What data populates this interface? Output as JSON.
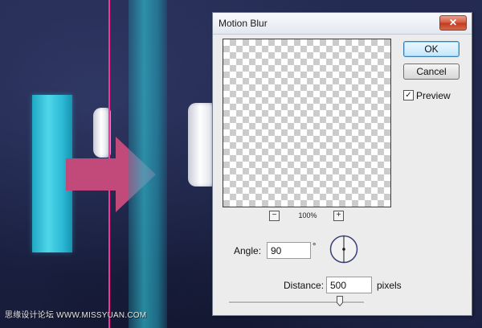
{
  "dialog": {
    "title": "Motion Blur",
    "close_label": "✕",
    "ok_label": "OK",
    "cancel_label": "Cancel",
    "preview_label": "Preview",
    "preview_checked": true,
    "zoom": {
      "minus_label": "−",
      "level": "100%",
      "plus_label": "+"
    },
    "angle": {
      "label": "Angle:",
      "value": "90",
      "unit": "°",
      "degrees": 90
    },
    "distance": {
      "label": "Distance:",
      "value": "500",
      "unit": "pixels",
      "slider_fraction": 0.82
    }
  },
  "canvas": {
    "watermark": "思缘设计论坛 WWW.MISSYUAN.COM",
    "colors": {
      "background": "#1c2245",
      "bar": "#3ac8e0",
      "guide": "#ff2f9a",
      "arrow": "#c24a7a"
    }
  }
}
